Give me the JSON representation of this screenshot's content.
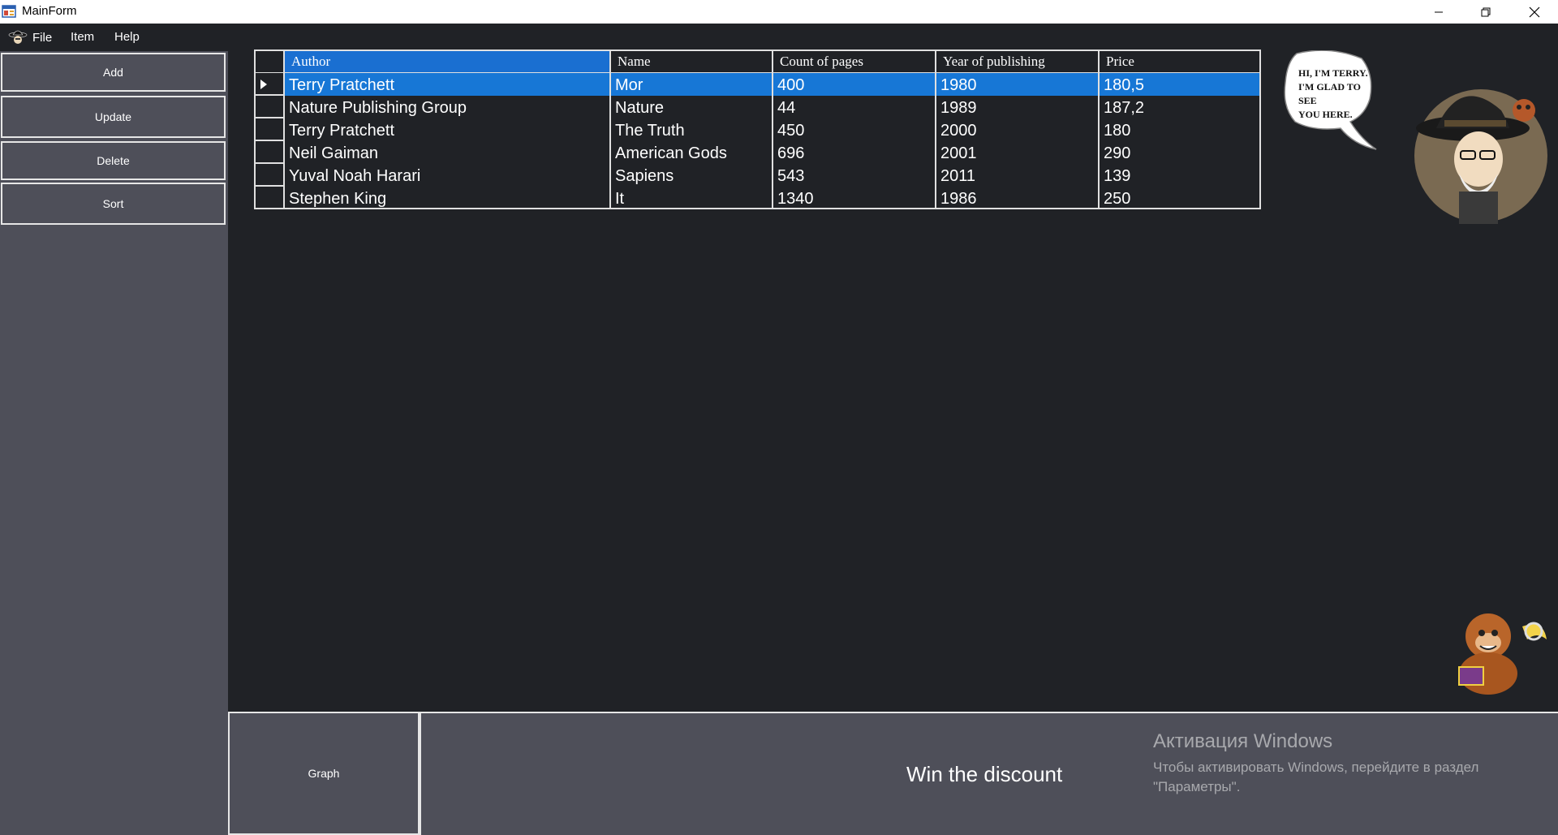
{
  "window": {
    "title": "MainForm",
    "icon": "app-form-icon",
    "controls": [
      "minimize-icon",
      "restore-icon",
      "close-icon"
    ]
  },
  "menu": {
    "file": "File",
    "item": "Item",
    "help": "Help"
  },
  "sidebar": {
    "add": "Add",
    "update": "Update",
    "delete": "Delete",
    "sort": "Sort"
  },
  "grid": {
    "columns": [
      "Author",
      "Name",
      "Count of pages",
      "Year  of publishing",
      "Price"
    ],
    "selected_row": 0,
    "rows": [
      [
        "Terry Pratchett",
        "Mor",
        "400",
        "1980",
        "180,5"
      ],
      [
        "Nature Publishing Group",
        "Nature",
        "44",
        "1989",
        "187,2"
      ],
      [
        "Terry Pratchett",
        "The Truth",
        "450",
        "2000",
        "180"
      ],
      [
        "Neil  Gaiman",
        "American Gods",
        "696",
        "2001",
        "290"
      ],
      [
        "Yuval Noah Harari",
        "Sapiens",
        "543",
        "2011",
        "139"
      ],
      [
        "Stephen King",
        "It",
        "1340",
        "1986",
        "250"
      ]
    ]
  },
  "speech_bubble": [
    "HI, I'M TERRY.",
    "I'M GLAD TO",
    "SEE",
    "YOU HERE."
  ],
  "bottom": {
    "graph": "Graph",
    "discount": "Win the discount"
  },
  "activation": {
    "title": "Активация Windows",
    "line1": "Чтобы активировать Windows, перейдите в раздел",
    "line2": "\"Параметры\"."
  },
  "colors": {
    "background": "#202226",
    "sidebar": "#4e4f59",
    "selection": "#1777d6",
    "header_selected": "#1a6fd1"
  }
}
